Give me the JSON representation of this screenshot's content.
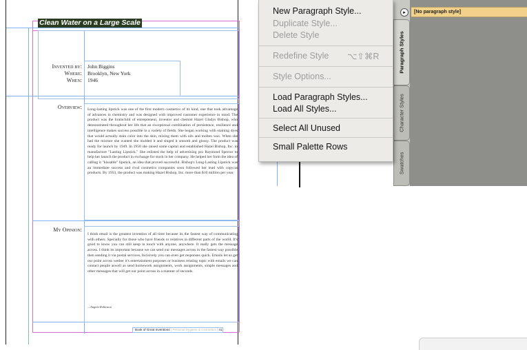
{
  "document": {
    "title": "Clean Water on a Large Scale",
    "invented_by_label": "Invented by:",
    "invented_by": "John Biggins",
    "where_label": "Where:",
    "where": "Brooklyn, New York",
    "when_label": "When:",
    "when": "1946",
    "overview_label": "Overview:",
    "overview_text": "Long-lasting lipstick was one of the first modern cosmetics of its kind, one that took advantage of advances in chemistry and was designed with improved customer experience in mind. The product was the brainchild of entrepreneur, inventor and chemist Hazel Gladys Bishop, who demonstrated throughout her life that an exceptional combination of persistence, resilience and intelligence makes success possible in a variety of fields. She began working with staining dyes that would actually stain color into the skin, mixing them with oils and molten wax. When she had the mixture she wanted she molded it and singed it smooth and glossy. The product was ready for launch by 1949. In 1950 she raised some capital and established Hazel Bishop, Inc. to manufacture \"Lasting Lipstick.\" She enlisted the help of advertising pro Raymond Spector to help her launch the product in exchange for stock in her company. He helped her form the idea of calling it \"kissable\" lipstick, an idea that proved successful. Bishop's Long-Lasting Lipstick was an immediate success and rival cosmetics companies soon followed her lead with copycat products. By 1953, the product was making Hazel Bishop, Inc. more than $10 million per year.",
    "opinion_label": "My Opinion:",
    "opinion_text": "I think email is the greatest invention of all time because its the fastest way of communicating with others. Specially for those who have friends or relatives in different parts of the world. It's good to know you can still keep in touch with anyone, anywhere. It really gets the message across. I think its important because we can send our messages across in the fastest way possible then sending it via postal services. Incisively you can even get responses quick. Emails let us get our point across wether it's entertainment purposes or business relating topic with emails we can contact people aswell as send homework assignments, work assignments, simple messages and other messages that will get our point across in a manner of seconds.",
    "signature": "—Angela Robinson",
    "footer_book": "Book of Great Inventions",
    "footer_section": "Personal Hygiene & Cosmetics",
    "footer_page": "41"
  },
  "menu": {
    "items": [
      {
        "label": "New Paragraph Style...",
        "enabled": true
      },
      {
        "label": "Duplicate Style...",
        "enabled": false
      },
      {
        "label": "Delete Style",
        "enabled": false
      },
      {
        "label": "Redefine Style",
        "enabled": false,
        "shortcut": "⌥⇧⌘R"
      },
      {
        "label": "Style Options...",
        "enabled": false
      },
      {
        "label": "Load Paragraph Styles...",
        "enabled": true
      },
      {
        "label": "Load All Styles...",
        "enabled": true
      },
      {
        "label": "Select All Unused",
        "enabled": true
      },
      {
        "label": "Small Palette Rows",
        "enabled": true
      }
    ]
  },
  "palette": {
    "selected_style": "[No paragraph style]",
    "tabs": [
      "Paragraph Styles",
      "Character Styles",
      "Swatches"
    ],
    "active_tab": "Paragraph Styles",
    "menu_arrow_icon": "▸"
  },
  "colors": {
    "highlight_row": "#f2d28a",
    "guide_blue": "#7fb2ee",
    "margin_magenta": "#d36bd3"
  }
}
